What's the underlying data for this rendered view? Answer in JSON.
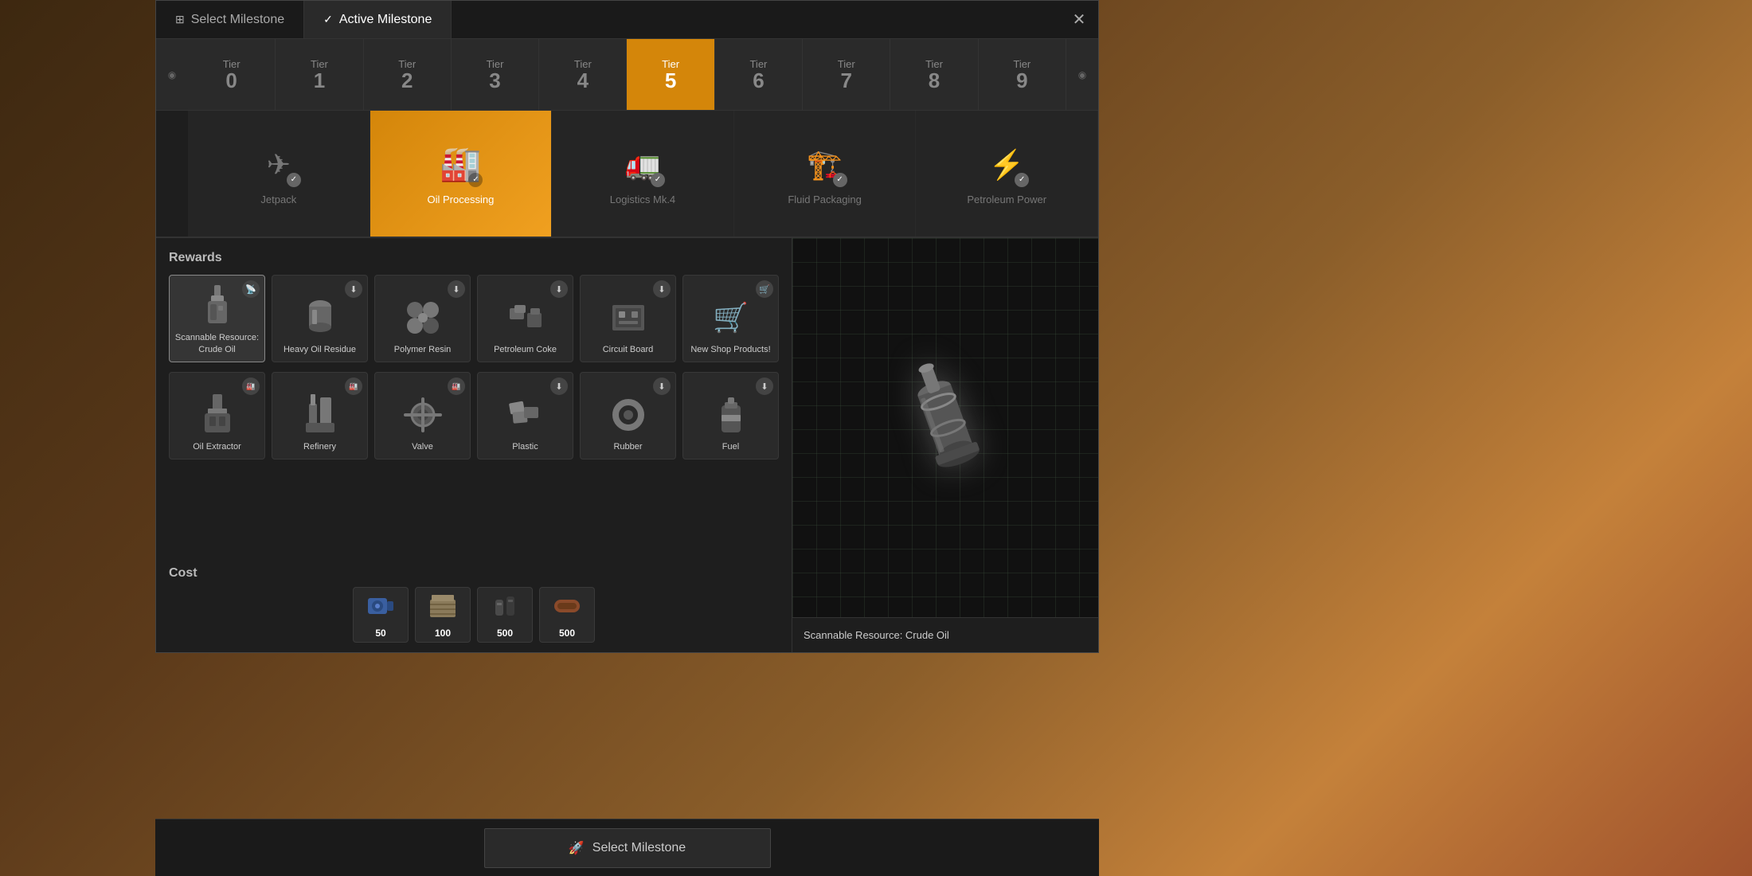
{
  "tabs": [
    {
      "id": "select",
      "label": "Select Milestone",
      "icon": "⊞",
      "active": false
    },
    {
      "id": "active",
      "label": "Active Milestone",
      "icon": "✓",
      "active": true
    }
  ],
  "close_label": "✕",
  "tiers": [
    {
      "label": "Tier",
      "num": "0"
    },
    {
      "label": "Tier",
      "num": "1"
    },
    {
      "label": "Tier",
      "num": "2"
    },
    {
      "label": "Tier",
      "num": "3"
    },
    {
      "label": "Tier",
      "num": "4"
    },
    {
      "label": "Tier",
      "num": "5",
      "selected": true
    },
    {
      "label": "Tier",
      "num": "6"
    },
    {
      "label": "Tier",
      "num": "7"
    },
    {
      "label": "Tier",
      "num": "8"
    },
    {
      "label": "Tier",
      "num": "9"
    }
  ],
  "milestones": [
    {
      "id": "jetpack",
      "label": "Jetpack",
      "icon": "🚀",
      "selected": false
    },
    {
      "id": "oil_processing",
      "label": "Oil Processing",
      "icon": "🏭",
      "selected": true
    },
    {
      "id": "logistics_mk4",
      "label": "Logistics Mk.4",
      "icon": "🚛",
      "selected": false
    },
    {
      "id": "fluid_packaging",
      "label": "Fluid Packaging",
      "icon": "🏗️",
      "selected": false
    },
    {
      "id": "petroleum_power",
      "label": "Petroleum Power",
      "icon": "⚡",
      "selected": false
    }
  ],
  "rewards_title": "Rewards",
  "rewards_row1": [
    {
      "id": "crude_oil",
      "name": "Scannable Resource: Crude Oil",
      "icon": "🔩",
      "badge": "📡",
      "selected": true
    },
    {
      "id": "heavy_oil",
      "name": "Heavy Oil Residue",
      "icon": "🛢️",
      "badge": "⬇️",
      "selected": false
    },
    {
      "id": "polymer_resin",
      "name": "Polymer Resin",
      "icon": "⚙️",
      "badge": "⬇️",
      "selected": false
    },
    {
      "id": "petroleum_coke",
      "name": "Petroleum Coke",
      "icon": "🪨",
      "badge": "⬇️",
      "selected": false
    },
    {
      "id": "circuit_board",
      "name": "Circuit Board",
      "icon": "💠",
      "badge": "⬇️",
      "selected": false
    },
    {
      "id": "new_shop",
      "name": "New Shop Products!",
      "icon": "🛒",
      "badge": "🛒",
      "selected": false
    }
  ],
  "rewards_row2": [
    {
      "id": "oil_extractor",
      "name": "Oil Extractor",
      "icon": "🔧",
      "badge": "🏭",
      "selected": false
    },
    {
      "id": "refinery",
      "name": "Refinery",
      "icon": "🏭",
      "badge": "🏭",
      "selected": false
    },
    {
      "id": "valve",
      "name": "Valve",
      "icon": "🔄",
      "badge": "🏭",
      "selected": false
    },
    {
      "id": "plastic",
      "name": "Plastic",
      "icon": "📦",
      "badge": "⬇️",
      "selected": false
    },
    {
      "id": "rubber",
      "name": "Rubber",
      "icon": "⭕",
      "badge": "⬇️",
      "selected": false
    },
    {
      "id": "fuel",
      "name": "Fuel",
      "icon": "⛽",
      "badge": "⬇️",
      "selected": false
    }
  ],
  "cost_title": "Cost",
  "cost_items": [
    {
      "id": "motors",
      "icon": "⚙️",
      "amount": "50",
      "color": "#3a5fa0"
    },
    {
      "id": "concrete",
      "icon": "🧱",
      "amount": "100",
      "color": "#8a7a5a"
    },
    {
      "id": "cables",
      "icon": "🔌",
      "amount": "500",
      "color": "#4a4a4a"
    },
    {
      "id": "pipes",
      "icon": "🔩",
      "amount": "500",
      "color": "#8a4a2a"
    }
  ],
  "preview_item_name": "Scannable Resource: Crude Oil",
  "select_milestone_btn_label": "Select Milestone",
  "select_milestone_icon": "🚀"
}
